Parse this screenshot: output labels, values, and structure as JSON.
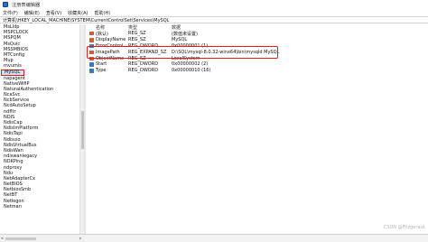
{
  "window": {
    "title": "注册表编辑器",
    "icon": "registry-editor-icon"
  },
  "menu": {
    "items": [
      "文件(F)",
      "编辑(E)",
      "查看(V)",
      "收藏夹(A)",
      "帮助(H)"
    ]
  },
  "address": {
    "path": "计算机\\HKEY_LOCAL_MACHINE\\SYSTEM\\CurrentControlSet\\Services\\MySQL"
  },
  "tree": {
    "items": [
      "MsLldp",
      "MSPCLOCK",
      "MSPQM",
      "MsQuic",
      "MSSMBIOS",
      "MTConfig",
      "Mup",
      "mvumis",
      "MySQL",
      "napagent",
      "NativeWifiP",
      "NaturalAuthentication",
      "NcaSvc",
      "NcbService",
      "NcdAutoSetup",
      "ndfltr",
      "NDIS",
      "NdisCap",
      "NdisImPlatform",
      "NdisTapi",
      "Ndisuio",
      "NdisVirtualBus",
      "NdisWan",
      "ndiswanlegacy",
      "NDKPing",
      "ndproxy",
      "Ndu",
      "NetAdapterCx",
      "NetBIOS",
      "NetbiosSmb",
      "NetBT",
      "Netlogon",
      "Netman"
    ],
    "selected": "MySQL"
  },
  "values": {
    "headers": {
      "name": "名称",
      "type": "类型",
      "data": "数据"
    },
    "rows": [
      {
        "name": "(默认)",
        "type": "REG_SZ",
        "data": "(数值未设置)",
        "icon": "string-value-icon"
      },
      {
        "name": "DisplayName",
        "type": "REG_SZ",
        "data": "MySQL",
        "icon": "string-value-icon"
      },
      {
        "name": "ErrorControl",
        "type": "REG_DWORD",
        "data": "0x00000001 (1)",
        "icon": "dword-value-icon"
      },
      {
        "name": "ImagePath",
        "type": "REG_EXPAND_SZ",
        "data": "D:\\SQL\\mysql-8.0.32-winx64\\bin\\mysqld MySQL",
        "icon": "string-value-icon"
      },
      {
        "name": "ObjectName",
        "type": "REG_SZ",
        "data": "LocalSystem",
        "icon": "string-value-icon"
      },
      {
        "name": "Start",
        "type": "REG_DWORD",
        "data": "0x00000002 (2)",
        "icon": "dword-value-icon"
      },
      {
        "name": "Type",
        "type": "REG_DWORD",
        "data": "0x00000010 (16)",
        "icon": "dword-value-icon"
      }
    ]
  },
  "watermark": "CSDN @Fitzgerald",
  "colors": {
    "selection": "#cce4f7",
    "annotation": "#e11c1c",
    "string_icon": "#d35a3a",
    "dword_icon": "#3a78c2"
  }
}
